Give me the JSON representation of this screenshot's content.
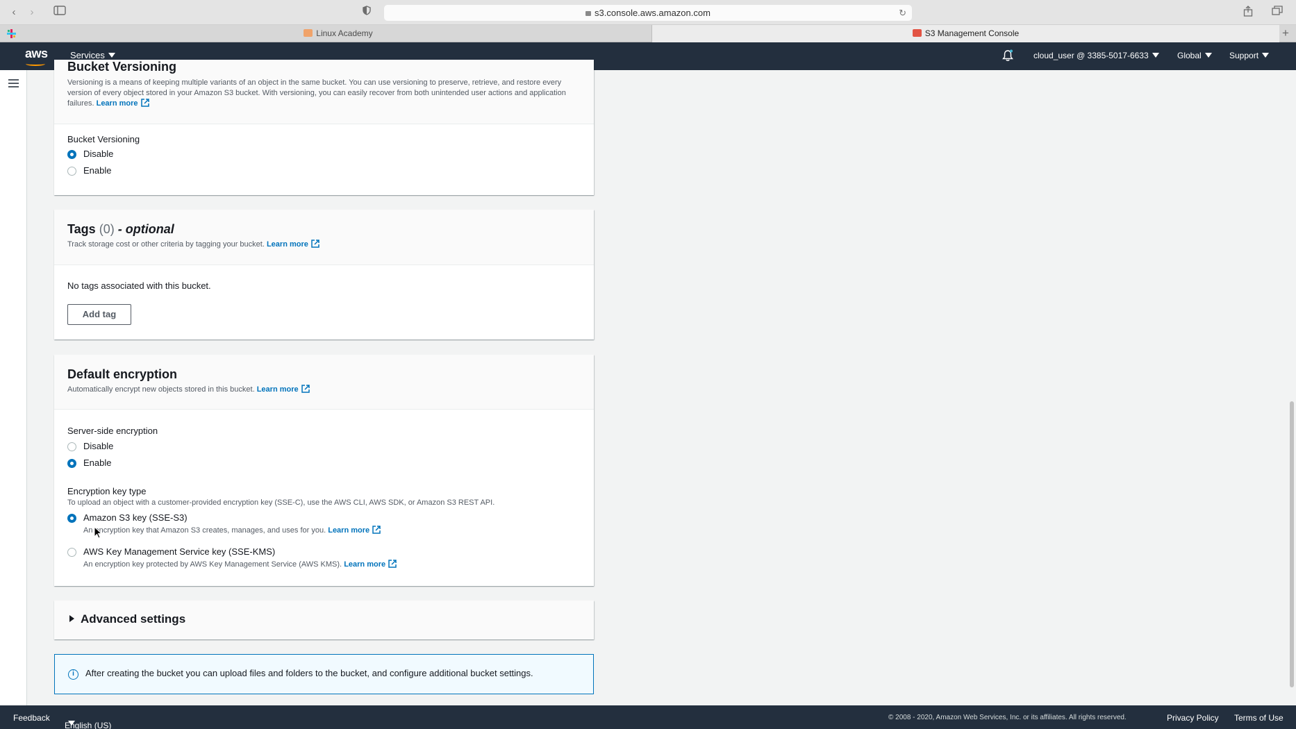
{
  "browser": {
    "url": "s3.console.aws.amazon.com",
    "tabs": [
      {
        "label": "Linux Academy",
        "active": false
      },
      {
        "label": "S3 Management Console",
        "active": true
      }
    ]
  },
  "aws_nav": {
    "logo": "aws",
    "services_label": "Services",
    "account_label": "cloud_user @ 3385-5017-6633",
    "region_label": "Global",
    "support_label": "Support"
  },
  "versioning": {
    "title": "Bucket Versioning",
    "description": "Versioning is a means of keeping multiple variants of an object in the same bucket. You can use versioning to preserve, retrieve, and restore every version of every object stored in your Amazon S3 bucket. With versioning, you can easily recover from both unintended user actions and application failures.",
    "learn_more": "Learn more",
    "field_label": "Bucket Versioning",
    "options": [
      {
        "label": "Disable",
        "selected": true
      },
      {
        "label": "Enable",
        "selected": false
      }
    ]
  },
  "tags": {
    "title": "Tags",
    "count": "(0)",
    "optional": "- optional",
    "description": "Track storage cost or other criteria by tagging your bucket.",
    "learn_more": "Learn more",
    "empty_text": "No tags associated with this bucket.",
    "add_tag_label": "Add tag"
  },
  "encryption": {
    "title": "Default encryption",
    "description": "Automatically encrypt new objects stored in this bucket.",
    "learn_more": "Learn more",
    "sse_label": "Server-side encryption",
    "sse_options": [
      {
        "label": "Disable",
        "selected": false
      },
      {
        "label": "Enable",
        "selected": true
      }
    ],
    "key_type_label": "Encryption key type",
    "key_type_description": "To upload an object with a customer-provided encryption key (SSE-C), use the AWS CLI, AWS SDK, or Amazon S3 REST API.",
    "key_options": [
      {
        "label": "Amazon S3 key (SSE-S3)",
        "description": "An encryption key that Amazon S3 creates, manages, and uses for you.",
        "learn_more": "Learn more",
        "selected": true
      },
      {
        "label": "AWS Key Management Service key (SSE-KMS)",
        "description": "An encryption key protected by AWS Key Management Service (AWS KMS).",
        "learn_more": "Learn more",
        "selected": false
      }
    ]
  },
  "advanced": {
    "title": "Advanced settings"
  },
  "info_banner": {
    "text": "After creating the bucket you can upload files and folders to the bucket, and configure additional bucket settings."
  },
  "footer": {
    "feedback": "Feedback",
    "language": "English (US)",
    "copyright": "© 2008 - 2020, Amazon Web Services, Inc. or its affiliates. All rights reserved.",
    "privacy": "Privacy Policy",
    "terms": "Terms of Use"
  },
  "colors": {
    "nav_bg": "#232f3e",
    "link": "#0073bb",
    "accent": "#ff9900"
  }
}
